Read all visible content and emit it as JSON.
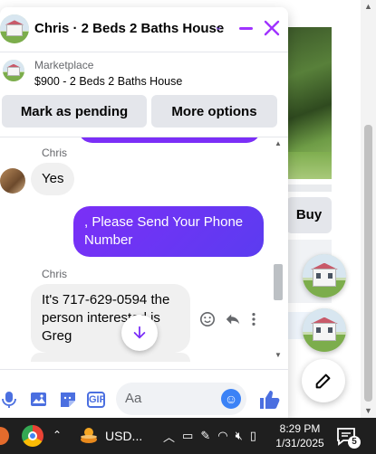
{
  "chat": {
    "contact": "Chris",
    "title": "Chris · 2 Beds 2 Baths House",
    "marketplace_label": "Marketplace",
    "listing_title": "$900 - 2 Beds 2 Baths House",
    "buttons": {
      "pending": "Mark as pending",
      "more": "More options"
    },
    "messages": [
      {
        "sender": "Chris",
        "text": "Yes",
        "direction": "incoming"
      },
      {
        "text": ", Please Send Your Phone Number",
        "direction": "outgoing"
      },
      {
        "sender": "Chris",
        "text": "It's 717-629-0594 the person interested is Greg",
        "direction": "incoming"
      }
    ],
    "composer_placeholder": "Aa",
    "accent_color": "#7b2ff7"
  },
  "background": {
    "buy_label": "Buy"
  },
  "taskbar": {
    "weather_label": "USD...",
    "time": "8:29 PM",
    "date": "1/31/2025",
    "notification_count": "5"
  }
}
